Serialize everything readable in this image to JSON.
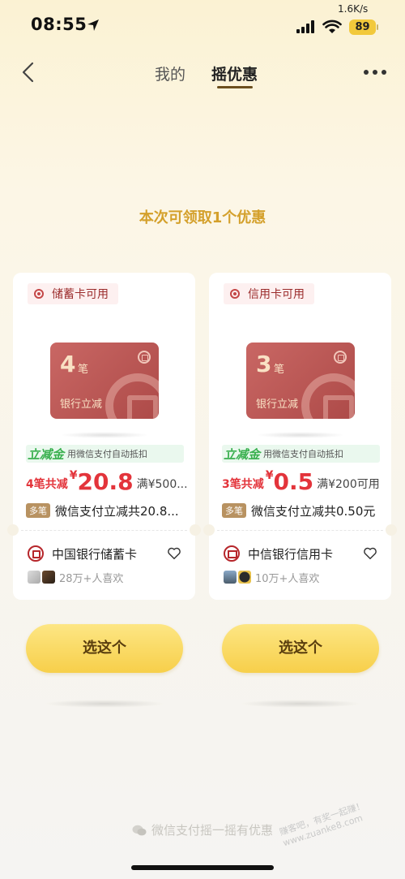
{
  "status_bar": {
    "time": "08:55",
    "net_speed": "1.6K/s",
    "battery": "89",
    "battery_color": "#f2c93b"
  },
  "nav": {
    "back_icon": "chevron-left-icon",
    "tabs": [
      {
        "label": "我的",
        "active": false
      },
      {
        "label": "摇优惠",
        "active": true
      }
    ],
    "more_icon": "more-dots-icon"
  },
  "headline": "本次可领取1个优惠",
  "offers": [
    {
      "usable_tag": "储蓄卡可用",
      "card_count": "4",
      "card_count_unit": "笔",
      "card_text": "银行立减",
      "lijianjin_title": "立减金",
      "lijianjin_desc": "用微信支付自动抵扣",
      "reduce_prefix": "4笔共减",
      "currency": "¥",
      "reduce_amount": "20.8",
      "reduce_condition": "满¥500...",
      "multi_tag": "多笔",
      "multi_text": "微信支付立减共20.8...",
      "bank_name": "中国银行储蓄卡",
      "likes": "28万+人喜欢",
      "choose_label": "选这个"
    },
    {
      "usable_tag": "信用卡可用",
      "card_count": "3",
      "card_count_unit": "笔",
      "card_text": "银行立减",
      "lijianjin_title": "立减金",
      "lijianjin_desc": "用微信支付自动抵扣",
      "reduce_prefix": "3笔共减",
      "currency": "¥",
      "reduce_amount": "0.5",
      "reduce_condition": "满¥200可用",
      "multi_tag": "多笔",
      "multi_text": "微信支付立减共0.50元",
      "bank_name": "中信银行信用卡",
      "likes": "10万+人喜欢",
      "choose_label": "选这个"
    }
  ],
  "footer": "微信支付摇一摇有优惠",
  "watermark": [
    "赚客吧，有奖一起赚！",
    "www.zuanke8.com"
  ],
  "colors": {
    "accent_gold": "#d4a02b",
    "reduce_red": "#e3343b",
    "lijianjin_green": "#3ab04f",
    "card_red": "#b8504d",
    "button_yellow": "#f7cf4a"
  }
}
